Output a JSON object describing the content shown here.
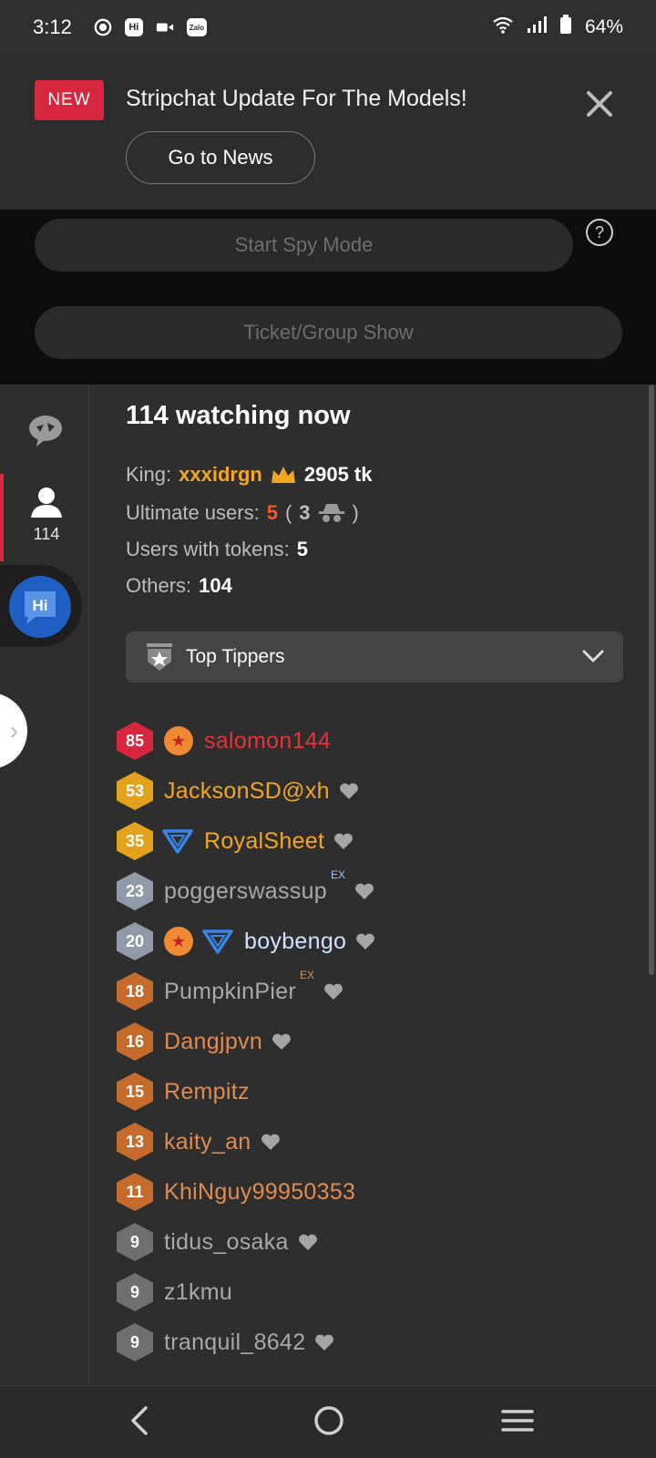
{
  "status_bar": {
    "time": "3:12",
    "notif_icons": [
      "record-icon",
      "hi-app-icon",
      "video-icon",
      "zalo-icon"
    ],
    "zalo_label": "Zalo",
    "hi_label": "Hi",
    "battery": "64%"
  },
  "banner": {
    "badge": "NEW",
    "title": "Stripchat Update For The Models!",
    "cta": "Go to News"
  },
  "controls": {
    "spy_label": "Start Spy Mode",
    "ticket_label": "Ticket/Group Show",
    "help_symbol": "?"
  },
  "sidenav": {
    "users_count": "114",
    "hi_label": "Hi"
  },
  "stats": {
    "watching": "114 watching now",
    "king_label": "King:",
    "king_name": "xxxidrgn",
    "king_tokens": "2905 tk",
    "ultimate_label": "Ultimate users:",
    "ultimate_value": "5",
    "ultimate_open": "(",
    "ultimate_hidden": "3",
    "ultimate_close": ")",
    "tokens_label": "Users with tokens:",
    "tokens_value": "5",
    "others_label": "Others:",
    "others_value": "104"
  },
  "dropdown": {
    "label": "Top Tippers"
  },
  "tippers": [
    {
      "level": "85",
      "name": "salomon144",
      "ex": ""
    },
    {
      "level": "53",
      "name": "JacksonSD@xh",
      "ex": ""
    },
    {
      "level": "35",
      "name": "RoyalSheet",
      "ex": ""
    },
    {
      "level": "23",
      "name": "poggerswassup",
      "ex": "EX"
    },
    {
      "level": "20",
      "name": "boybengo",
      "ex": ""
    },
    {
      "level": "18",
      "name": "PumpkinPier",
      "ex": "EX"
    },
    {
      "level": "16",
      "name": "Dangjpvn",
      "ex": ""
    },
    {
      "level": "15",
      "name": "Rempitz",
      "ex": ""
    },
    {
      "level": "13",
      "name": "kaity_an",
      "ex": ""
    },
    {
      "level": "11",
      "name": "KhiNguy99950353",
      "ex": ""
    },
    {
      "level": "9",
      "name": "tidus_osaka",
      "ex": ""
    },
    {
      "level": "9",
      "name": "z1kmu",
      "ex": ""
    },
    {
      "level": "9",
      "name": "tranquil_8642",
      "ex": ""
    }
  ],
  "colors": {
    "accent": "#d7263d",
    "king": "#f3a524",
    "ultimate": "#f05a28"
  }
}
